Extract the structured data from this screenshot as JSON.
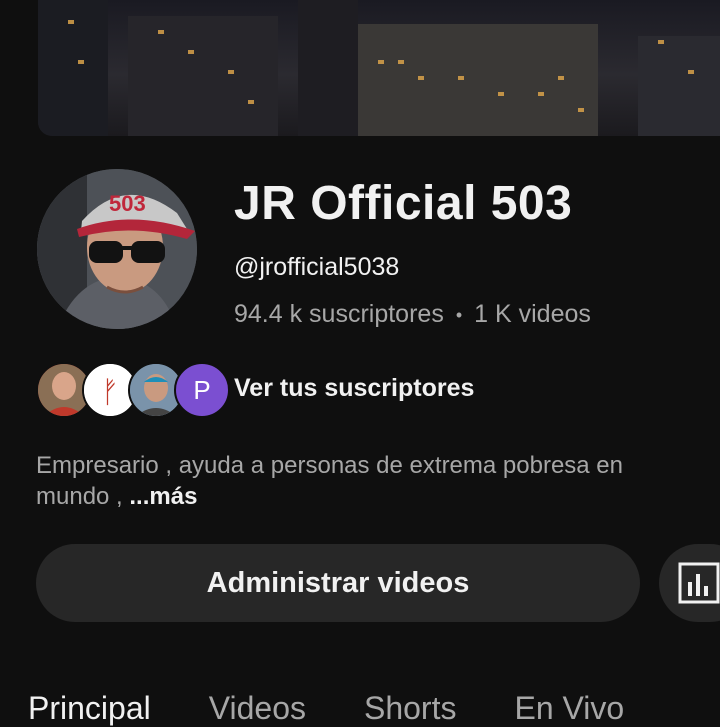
{
  "channel": {
    "name": "JR Official 503",
    "handle": "@jrofficial5038",
    "subscribers": "94.4 k suscriptores",
    "videos": "1 K videos",
    "separator": "•",
    "avatar_cap_text": "503"
  },
  "subscribers_preview": {
    "link_label": "Ver tus suscriptores",
    "avatars": [
      {
        "type": "photo"
      },
      {
        "type": "logo",
        "glyph": "ᚠ"
      },
      {
        "type": "photo"
      },
      {
        "type": "letter",
        "letter": "P",
        "color": "#7b4fd1"
      }
    ]
  },
  "description": {
    "line1": "Empresario , ayuda a personas de extrema pobresa en",
    "line2": "mundo ,",
    "more": "...más"
  },
  "actions": {
    "manage_videos": "Administrar videos",
    "stats_icon": "analytics-icon"
  },
  "tabs": [
    {
      "label": "Principal",
      "active": true
    },
    {
      "label": "Videos",
      "active": false
    },
    {
      "label": "Shorts",
      "active": false
    },
    {
      "label": "En Vivo",
      "active": false
    }
  ],
  "colors": {
    "background": "#0f0f0f",
    "button": "#272727",
    "secondary_text": "#a7a7a7",
    "primary_text": "#f1f1f1"
  }
}
